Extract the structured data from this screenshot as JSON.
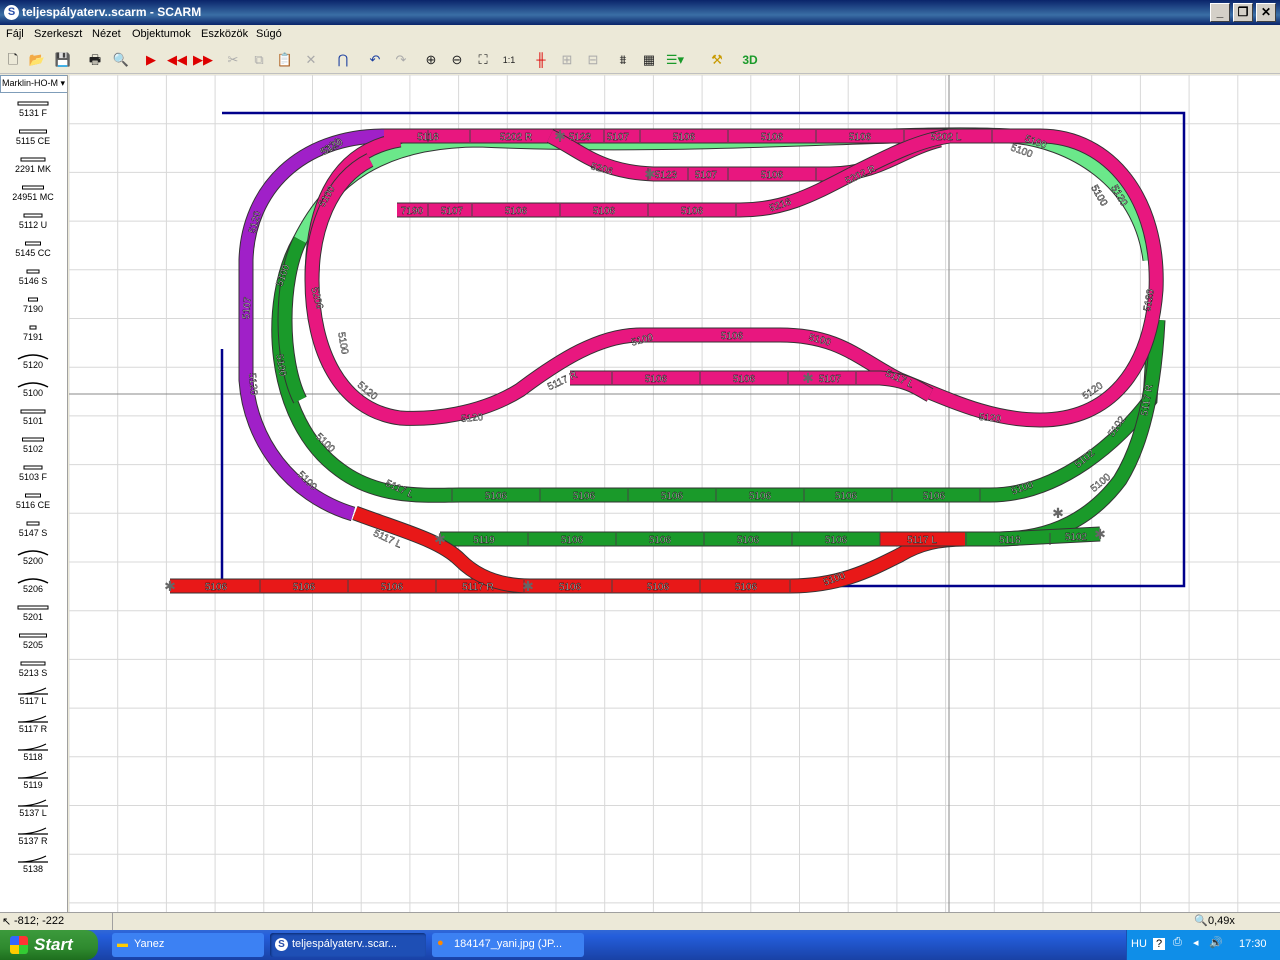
{
  "window": {
    "title": "teljespályaterv..scarm - SCARM",
    "app_icon": "S"
  },
  "menu": [
    "Fájl",
    "Szerkeszt",
    "Nézet",
    "Objektumok",
    "Eszközök",
    "Súgó"
  ],
  "toolbar": {
    "icons": [
      "new-icon",
      "open-icon",
      "save-icon",
      "print-icon",
      "print-preview-icon",
      "run-icon",
      "rewind-icon",
      "forward-icon",
      "cut-icon",
      "copy-icon",
      "paste-icon",
      "delete-icon",
      "magnet-icon",
      "undo-icon",
      "redo-icon",
      "zoom-in-icon",
      "zoom-out-icon",
      "fit-icon",
      "zoom-1-icon",
      "flex-track-icon",
      "join-icon",
      "split-icon",
      "bridge-icon",
      "tunnel-icon",
      "layer-icon",
      "measure-icon"
    ],
    "three_d_label": "3D"
  },
  "palette": {
    "library": "Marklin-HO-M",
    "items": [
      "5131 F",
      "5115 CE",
      "2291 MK",
      "24951 MC",
      "5112 U",
      "5145 CC",
      "5146 S",
      "7190",
      "7191",
      "5120",
      "5100",
      "5101",
      "5102",
      "5103 F",
      "5116 CE",
      "5147 S",
      "5200",
      "5206",
      "5201",
      "5205",
      "5213 S",
      "5117 L",
      "5117 R",
      "5118",
      "5119",
      "5137 L",
      "5137 R",
      "5138"
    ]
  },
  "status": {
    "coords": "-812; -222",
    "zoom": "0,49x"
  },
  "taskbar": {
    "start": "Start",
    "tasks": [
      "Yanez",
      "teljespályaterv..scar...",
      "184147_yani.jpg (JP..."
    ],
    "language": "HU",
    "time": "17:30"
  },
  "colors": {
    "pink": "#e8177f",
    "light_green": "#6be88a",
    "dark_green": "#1a9a2a",
    "purple": "#a020c8",
    "red": "#e81818",
    "board": "#00008b"
  },
  "track_labels": {
    "pink_top": [
      "5118",
      "5202 R",
      "5123",
      "5107",
      "5106",
      "5106",
      "5106",
      "5202 L",
      "5100",
      "5120"
    ],
    "pink_mid": [
      "5206",
      "5123",
      "5107",
      "5106",
      "5202 R"
    ],
    "pink_third": [
      "7190",
      "5107",
      "5106",
      "5106",
      "5106",
      "5216"
    ],
    "pink_loop": [
      "5120",
      "5206",
      "5120",
      "5120",
      "5120",
      "5120",
      "5120"
    ],
    "pink_center_top": [
      "5100",
      "5106",
      "5100"
    ],
    "pink_center_mid": [
      "5117 R",
      "5106",
      "5106",
      "5107",
      "5117 L"
    ],
    "pink_right": [
      "5120",
      "5100",
      "5120"
    ],
    "green_upper": [
      "5106",
      "5106",
      "5106",
      "5106",
      "5106",
      "5106",
      "5100",
      "5117 L"
    ],
    "green_lower": [
      "5119",
      "5106",
      "5106",
      "5106",
      "5106",
      "5117 L",
      "5118",
      "5102"
    ],
    "green_left": [
      "5100",
      "5100",
      "5100",
      "5100"
    ],
    "green_right": [
      "5102",
      "5102",
      "5117 R",
      "5100"
    ],
    "purple": [
      "5120",
      "5120",
      "5107",
      "5120",
      "5100"
    ],
    "light_green": [
      "5100",
      "5100",
      "5100"
    ],
    "red_bottom": [
      "5106",
      "5106",
      "5106",
      "5117 R",
      "5106",
      "5106",
      "5106",
      "5100"
    ],
    "red_diag": [
      "5117 L"
    ]
  }
}
